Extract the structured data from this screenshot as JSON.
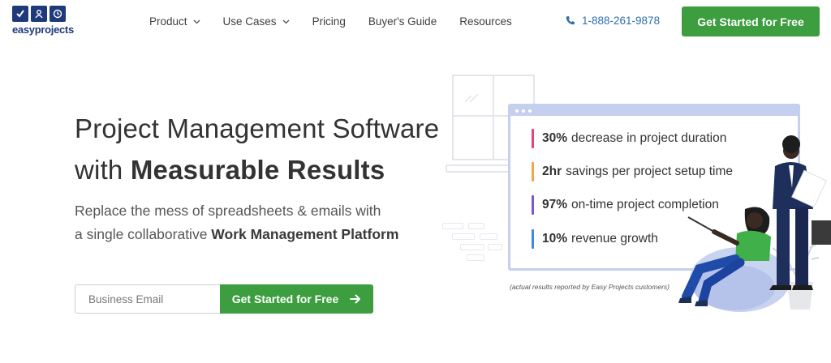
{
  "brand": {
    "logo_text": "easyprojects"
  },
  "nav": {
    "items": [
      {
        "label": "Product",
        "dropdown": true
      },
      {
        "label": "Use Cases",
        "dropdown": true
      },
      {
        "label": "Pricing",
        "dropdown": false
      },
      {
        "label": "Buyer's Guide",
        "dropdown": false
      },
      {
        "label": "Resources",
        "dropdown": false
      }
    ]
  },
  "phone": {
    "number": "1-888-261-9878"
  },
  "header_cta": {
    "label": "Get Started for Free"
  },
  "hero": {
    "headline_line1": "Project Management Software",
    "headline_line2_prefix": "with ",
    "headline_line2_bold": "Measurable Results",
    "subhead_line1": "Replace the mess of spreadsheets & emails with",
    "subhead_line2_prefix": "a single collaborative ",
    "subhead_line2_bold": "Work Management Platform"
  },
  "form": {
    "email_placeholder": "Business Email",
    "email_value": "",
    "submit_label": "Get Started for Free"
  },
  "stats": [
    {
      "value": "30%",
      "text": "decrease in project duration",
      "color": "#e0457b"
    },
    {
      "value": "2hr",
      "text": "savings per project setup time",
      "color": "#f0a64a"
    },
    {
      "value": "97%",
      "text": "on-time project completion",
      "color": "#7b57d6"
    },
    {
      "value": "10%",
      "text": "revenue growth",
      "color": "#3f8be0"
    }
  ],
  "stats_caption": "(actual results reported by Easy Projects customers)",
  "colors": {
    "primary_green": "#3c9e3f",
    "brand_navy": "#1f3a7a",
    "link_blue": "#2f6fb0",
    "panel_border": "#c5d0ee"
  },
  "icons": [
    "checkbox-icon",
    "user-icon",
    "clock-icon",
    "chevron-down-icon",
    "phone-icon",
    "arrow-right-icon"
  ]
}
